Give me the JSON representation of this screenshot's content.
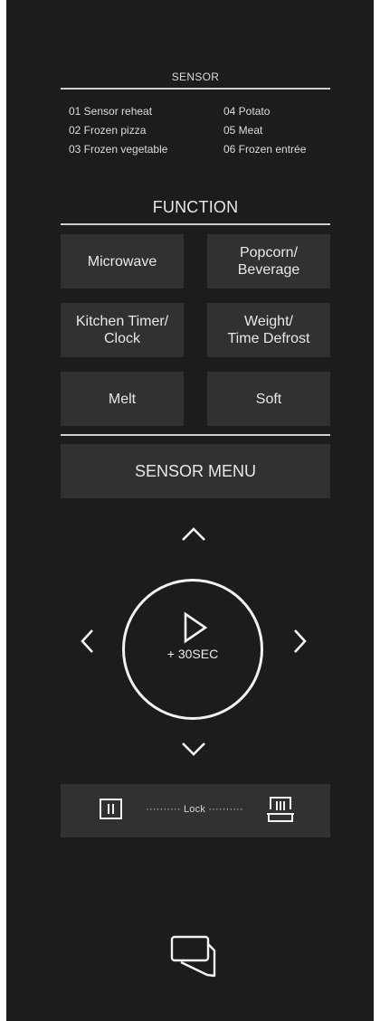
{
  "sensor": {
    "title": "SENSOR",
    "items": [
      "01  Sensor reheat",
      "02  Frozen pizza",
      "03  Frozen vegetable",
      "04  Potato",
      "05  Meat",
      "06  Frozen entrée"
    ]
  },
  "function": {
    "title": "FUNCTION",
    "buttons": {
      "microwave": "Microwave",
      "popcorn_line1": "Popcorn/",
      "popcorn_line2": "Beverage",
      "timer_line1": "Kitchen Timer/",
      "timer_line2": "Clock",
      "defrost_line1": "Weight/",
      "defrost_line2": "Time Defrost",
      "melt": "Melt",
      "soft": "Soft"
    }
  },
  "sensor_menu": {
    "label": "SENSOR MENU"
  },
  "dial": {
    "start_label": "+ 30SEC"
  },
  "lock": {
    "label": "·········· Lock ··········"
  },
  "icons": {
    "up": "chevron-up-icon",
    "down": "chevron-down-icon",
    "left": "chevron-left-icon",
    "right": "chevron-right-icon",
    "play": "play-icon",
    "pause": "pause-icon",
    "lock": "child-lock-icon",
    "door": "door-open-icon"
  },
  "colors": {
    "panel": "#1c1c1c",
    "button": "#313131",
    "text": "#e6e6e6"
  }
}
